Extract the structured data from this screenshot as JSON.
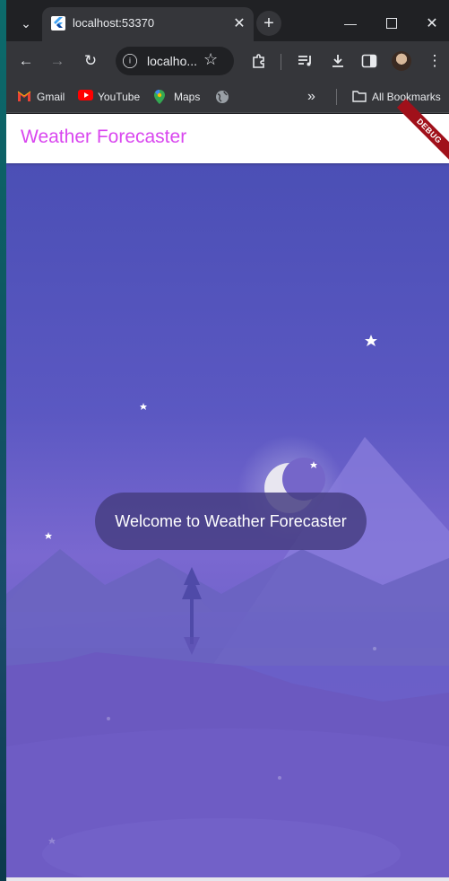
{
  "browser": {
    "tab": {
      "title": "localhost:53370"
    },
    "omnibox": {
      "text": "localho..."
    },
    "bookmarks": [
      {
        "label": "Gmail",
        "icon": "gmail-icon"
      },
      {
        "label": "YouTube",
        "icon": "youtube-icon"
      },
      {
        "label": "Maps",
        "icon": "maps-icon"
      },
      {
        "label": "",
        "icon": "globe-icon"
      }
    ],
    "all_bookmarks_label": "All Bookmarks"
  },
  "app": {
    "title": "Weather Forecaster",
    "debug_banner": "DEBUG",
    "toast": "Welcome to Weather Forecaster",
    "colors": {
      "title": "#d946ef",
      "sky_top": "#4b4fb5",
      "sky_bottom": "#7060c6"
    }
  }
}
